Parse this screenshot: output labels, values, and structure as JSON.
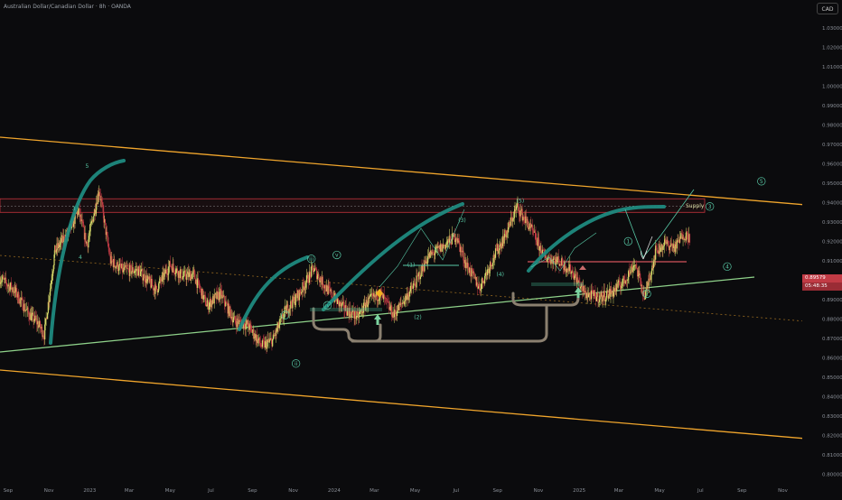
{
  "header": {
    "title": "Australian Dollar/Canadian Dollar · 8h · OANDA",
    "currency": "CAD"
  },
  "price_tags": {
    "current": "0.89579",
    "countdown": "05:48:35"
  },
  "colors": {
    "background": "#0b0b0d",
    "candle_up": "#d8dc6a",
    "candle_down": "#c23b45",
    "wave_arc": "#1f8a80",
    "channel": "#f0a52c",
    "support_line": "#8fd28a",
    "supply_zone": "#c2343c",
    "base_bracket": "#8b8070",
    "wave_label": "#58c9a6"
  },
  "chart_data": {
    "type": "line",
    "title": "Australian Dollar/Canadian Dollar · 8h · OANDA",
    "xlabel": "",
    "ylabel": "",
    "y_axis_side": "right",
    "ylim": [
      0.795,
      1.045
    ],
    "x_ticks": [
      "Sep",
      "Nov",
      "2023",
      "Mar",
      "May",
      "Jul",
      "Sep",
      "Nov",
      "2024",
      "Mar",
      "May",
      "Jul",
      "Sep",
      "Nov",
      "2025",
      "Mar",
      "May",
      "Jul",
      "Sep",
      "Nov"
    ],
    "y_ticks": [
      0.8,
      0.81,
      0.82,
      0.83,
      0.84,
      0.85,
      0.86,
      0.87,
      0.88,
      0.89,
      0.9,
      0.91,
      0.92,
      0.93,
      0.94,
      0.95,
      0.96,
      0.97,
      0.98,
      0.99,
      1.0,
      1.01,
      1.02,
      1.03
    ],
    "y_tick_labels": [
      "0.80000",
      "0.81000",
      "0.82000",
      "0.83000",
      "0.84000",
      "0.85000",
      "0.86000",
      "0.87000",
      "0.88000",
      "0.89000",
      "0.90000",
      "0.91000",
      "0.92000",
      "0.93000",
      "0.94000",
      "0.95000",
      "0.96000",
      "0.97000",
      "0.98000",
      "0.99000",
      "1.00000",
      "1.01000",
      "1.02000",
      "1.03000"
    ],
    "grid": false,
    "series": [
      {
        "x": [
          "2022-08-20",
          "2022-09-10",
          "2022-10-01",
          "2022-10-15",
          "2022-10-25",
          "2022-11-10",
          "2022-12-01",
          "2022-12-15",
          "2022-12-28",
          "2023-01-15",
          "2023-02-01",
          "2023-02-20",
          "2023-03-15",
          "2023-04-10",
          "2023-05-01",
          "2023-05-20",
          "2023-06-05",
          "2023-06-25",
          "2023-07-15",
          "2023-08-05",
          "2023-08-25",
          "2023-09-15",
          "2023-10-01",
          "2023-10-20",
          "2023-11-10",
          "2023-12-01",
          "2023-12-20",
          "2024-01-10",
          "2024-02-05",
          "2024-02-20",
          "2024-03-10",
          "2024-03-30",
          "2024-04-15",
          "2024-05-01",
          "2024-05-20",
          "2024-06-10",
          "2024-07-01",
          "2024-07-15",
          "2024-08-05",
          "2024-08-25",
          "2024-09-15",
          "2024-09-30",
          "2024-10-20",
          "2024-11-10",
          "2024-12-01",
          "2024-12-20",
          "2025-01-10",
          "2025-02-01",
          "2025-02-20",
          "2025-03-10",
          "2025-03-25",
          "2025-04-09",
          "2025-04-25",
          "2025-05-10",
          "2025-05-25",
          "2025-06-05",
          "2025-06-15"
        ],
        "y": [
          0.901,
          0.895,
          0.883,
          0.878,
          0.872,
          0.915,
          0.925,
          0.936,
          0.918,
          0.947,
          0.91,
          0.905,
          0.905,
          0.895,
          0.908,
          0.902,
          0.903,
          0.887,
          0.893,
          0.879,
          0.877,
          0.866,
          0.869,
          0.884,
          0.893,
          0.906,
          0.896,
          0.887,
          0.881,
          0.889,
          0.893,
          0.882,
          0.89,
          0.898,
          0.912,
          0.917,
          0.923,
          0.909,
          0.896,
          0.911,
          0.925,
          0.938,
          0.927,
          0.912,
          0.91,
          0.905,
          0.893,
          0.891,
          0.894,
          0.9,
          0.909,
          0.891,
          0.915,
          0.919,
          0.917,
          0.924,
          0.922
        ]
      }
    ],
    "annotations": {
      "wave_labels": [
        {
          "text": "5",
          "x": "2022-12-28",
          "y": 0.958
        },
        {
          "text": "3",
          "x": "2022-12-08",
          "y": 0.936
        },
        {
          "text": "4",
          "x": "2022-12-18",
          "y": 0.911
        },
        {
          "text": "iii",
          "x": "2023-11-28",
          "y": 0.91
        },
        {
          "text": "v",
          "x": "2024-01-05",
          "y": 0.912
        },
        {
          "text": "iv",
          "x": "2023-12-22",
          "y": 0.886
        },
        {
          "text": "i",
          "x": "2023-10-20",
          "y": 0.881
        },
        {
          "text": "ii",
          "x": "2023-11-05",
          "y": 0.856
        },
        {
          "text": "(1)",
          "x": "2024-04-25",
          "y": 0.907
        },
        {
          "text": "(2)",
          "x": "2024-05-05",
          "y": 0.88
        },
        {
          "text": "(3)",
          "x": "2024-07-10",
          "y": 0.93
        },
        {
          "text": "(4)",
          "x": "2024-09-05",
          "y": 0.902
        },
        {
          "text": "(5)",
          "x": "2024-10-05",
          "y": 0.94
        },
        {
          "text": "1",
          "x": "2025-03-15",
          "y": 0.919
        },
        {
          "text": "2",
          "x": "2025-04-12",
          "y": 0.892
        },
        {
          "text": "3",
          "x": "2025-07-15",
          "y": 0.937
        },
        {
          "text": "4",
          "x": "2025-08-10",
          "y": 0.906
        },
        {
          "text": "5",
          "x": "2025-09-30",
          "y": 0.95
        }
      ],
      "supply_label": "Supply",
      "supply_zone": [
        0.935,
        0.942
      ]
    }
  }
}
